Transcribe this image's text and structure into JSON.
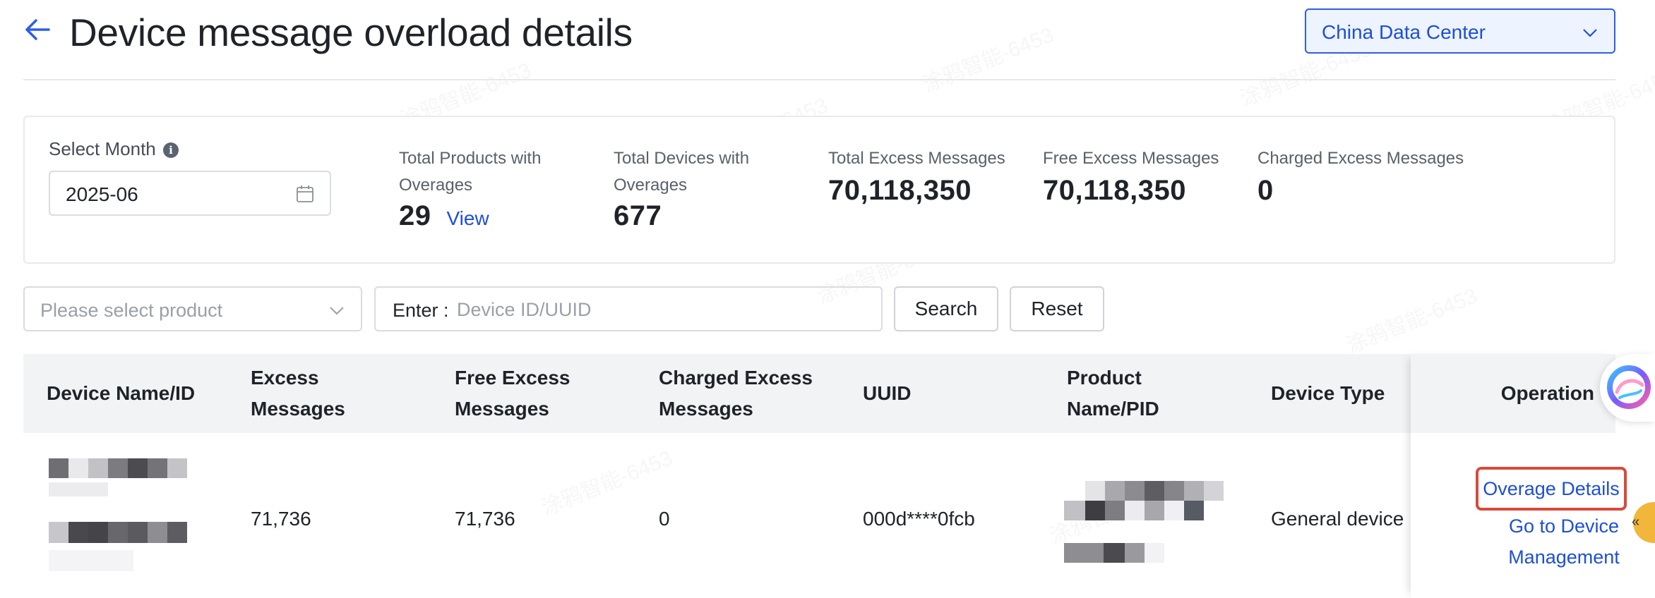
{
  "header": {
    "title": "Device message overload details",
    "data_center": "China Data Center"
  },
  "summary": {
    "month_label": "Select Month",
    "month_value": "2025-06",
    "stats": [
      {
        "label_line1": "Total Products with",
        "label_line2": "Overages",
        "value": "29",
        "action": "View"
      },
      {
        "label_line1": "Total Devices with",
        "label_line2": "Overages",
        "value": "677"
      },
      {
        "label": "Total Excess Messages",
        "value": "70,118,350"
      },
      {
        "label": "Free Excess Messages",
        "value": "70,118,350"
      },
      {
        "label": "Charged Excess Messages",
        "value": "0"
      }
    ]
  },
  "filters": {
    "product_placeholder": "Please select product",
    "search_prefix": "Enter :",
    "search_placeholder": "Device ID/UUID",
    "search_button": "Search",
    "reset_button": "Reset"
  },
  "table": {
    "headers": {
      "device": "Device Name/ID",
      "excess_1": "Excess",
      "excess_2": "Messages",
      "free_1": "Free Excess",
      "free_2": "Messages",
      "charged_1": "Charged Excess",
      "charged_2": "Messages",
      "uuid": "UUID",
      "product_1": "Product",
      "product_2": "Name/PID",
      "device_type": "Device Type",
      "operation": "Operation"
    },
    "rows": [
      {
        "excess": "71,736",
        "free_excess": "71,736",
        "charged_excess": "0",
        "uuid": "000d****0fcb",
        "device_type": "General device",
        "op_overage": "Overage Details",
        "op_goto_1": "Go to Device",
        "op_goto_2": "Management"
      }
    ]
  },
  "colors": {
    "accent": "#1d4fd8",
    "highlight_border": "#d94a3a",
    "header_bg": "#f2f3f5"
  }
}
